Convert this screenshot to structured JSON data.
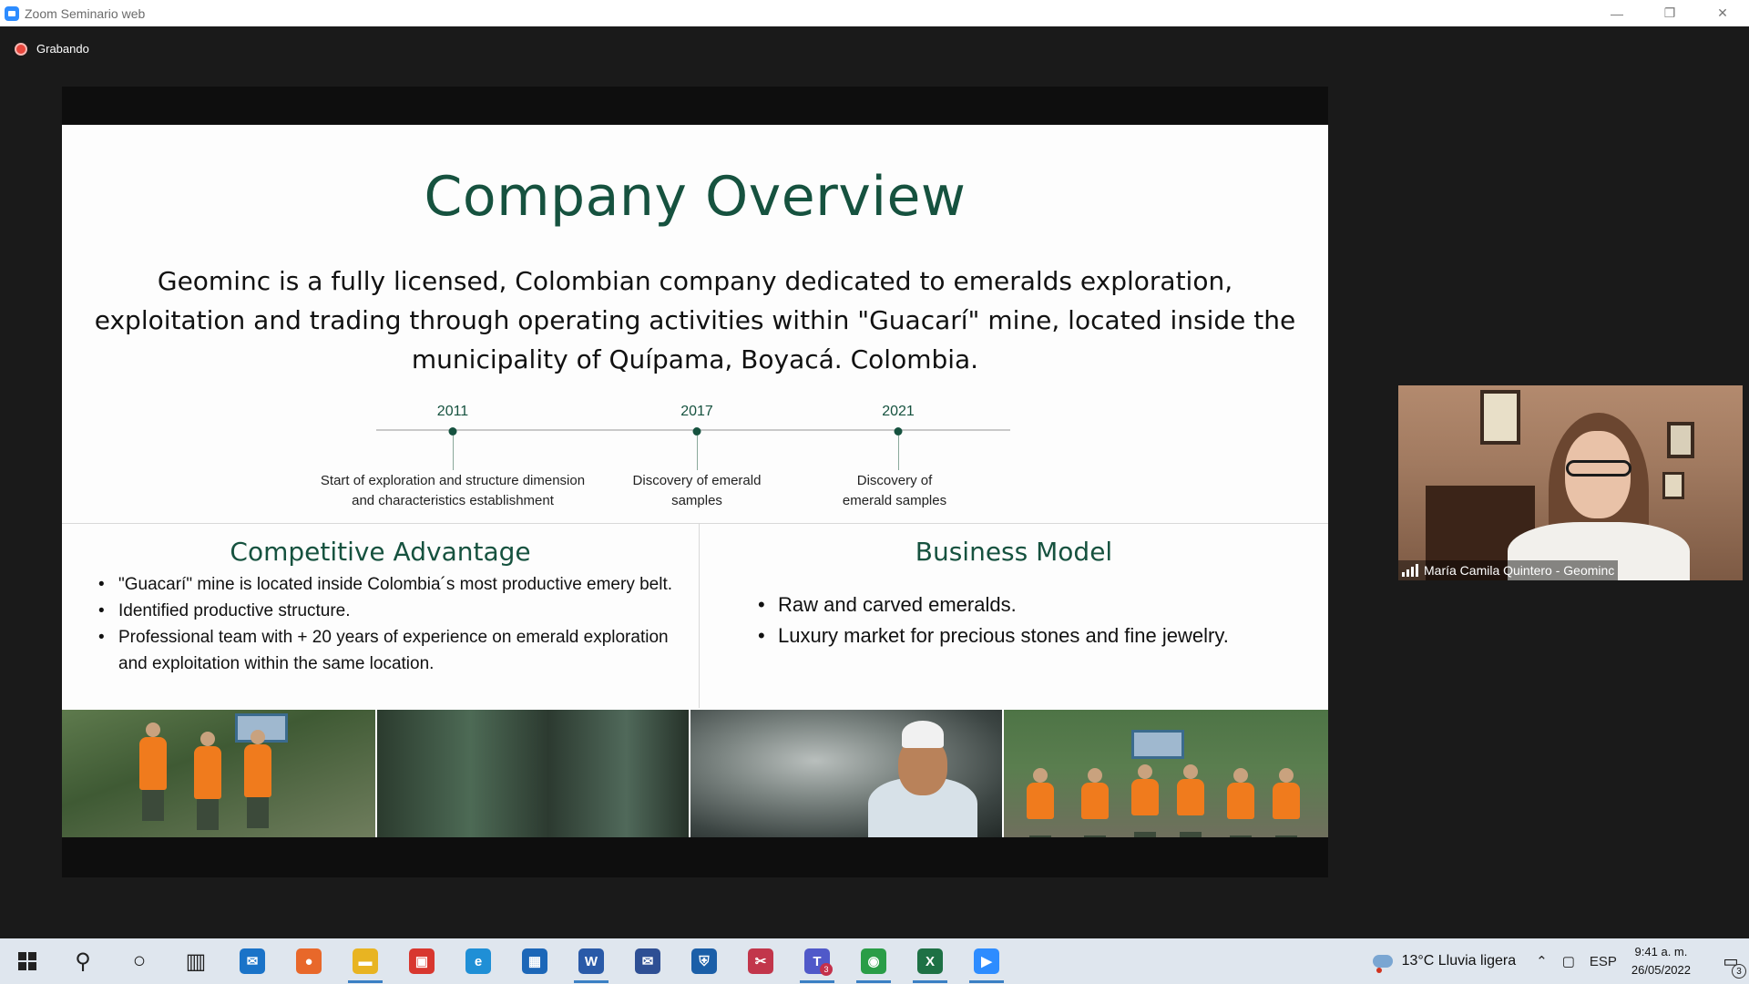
{
  "window": {
    "title": "Zoom Seminario web",
    "minimize": "—",
    "restore": "❐",
    "close": "✕"
  },
  "meeting": {
    "recording_label": "Grabando"
  },
  "slide": {
    "title": "Company Overview",
    "description": "Geominc  is a fully licensed, Colombian company dedicated to emeralds exploration, exploitation and trading through operating activities within \"Guacarí\" mine, located inside the municipality of Quípama, Boyacá. Colombia.",
    "timeline": [
      {
        "year": "2011",
        "line1": "Start of exploration and structure dimension",
        "line2": "and characteristics establishment"
      },
      {
        "year": "2017",
        "line1": "Discovery of emerald",
        "line2": "samples"
      },
      {
        "year": "2021",
        "line1": "Discovery of",
        "line2": "emerald samples"
      }
    ],
    "competitive_advantage": {
      "title": "Competitive Advantage",
      "items": [
        "\"Guacarí\" mine is located inside Colombia´s most productive emery belt.",
        "Identified productive structure.",
        "Professional team with + 20 years of experience on emerald exploration and exploitation within the same location."
      ]
    },
    "business_model": {
      "title": "Business Model",
      "items": [
        "Raw and carved emeralds.",
        "Luxury market for precious stones and fine jewelry."
      ]
    }
  },
  "video": {
    "participant_name": "María Camila Quintero - Geominc"
  },
  "taskbar": {
    "apps": [
      {
        "name": "search",
        "glyph": "⚲",
        "color": "#222"
      },
      {
        "name": "cortana",
        "glyph": "○",
        "color": "#222"
      },
      {
        "name": "task-view",
        "glyph": "▥",
        "color": "#222"
      },
      {
        "name": "mail",
        "glyph": "✉",
        "color": "#1a73c8"
      },
      {
        "name": "firefox",
        "glyph": "●",
        "color": "#e8682a"
      },
      {
        "name": "file-explorer",
        "glyph": "▬",
        "color": "#e8b422"
      },
      {
        "name": "gift",
        "glyph": "▣",
        "color": "#d8372f"
      },
      {
        "name": "edge",
        "glyph": "e",
        "color": "#1f8fd6"
      },
      {
        "name": "store",
        "glyph": "▦",
        "color": "#1c67b8"
      },
      {
        "name": "word",
        "glyph": "W",
        "color": "#2a5aa8"
      },
      {
        "name": "mail-sync",
        "glyph": "✉",
        "color": "#2e4f94"
      },
      {
        "name": "shield",
        "glyph": "⛨",
        "color": "#1b5fa8"
      },
      {
        "name": "snipping-tool",
        "glyph": "✂",
        "color": "#c2364b"
      },
      {
        "name": "teams",
        "glyph": "T",
        "color": "#5059c9"
      },
      {
        "name": "chrome",
        "glyph": "◉",
        "color": "#2a9d47"
      },
      {
        "name": "excel",
        "glyph": "X",
        "color": "#1e7145"
      },
      {
        "name": "zoom",
        "glyph": "▶",
        "color": "#2d8cff"
      }
    ],
    "teams_badge": "3",
    "weather": "13°C  Lluvia ligera",
    "language": "ESP",
    "time": "9:41 a. m.",
    "date": "26/05/2022",
    "notifications": "3"
  }
}
